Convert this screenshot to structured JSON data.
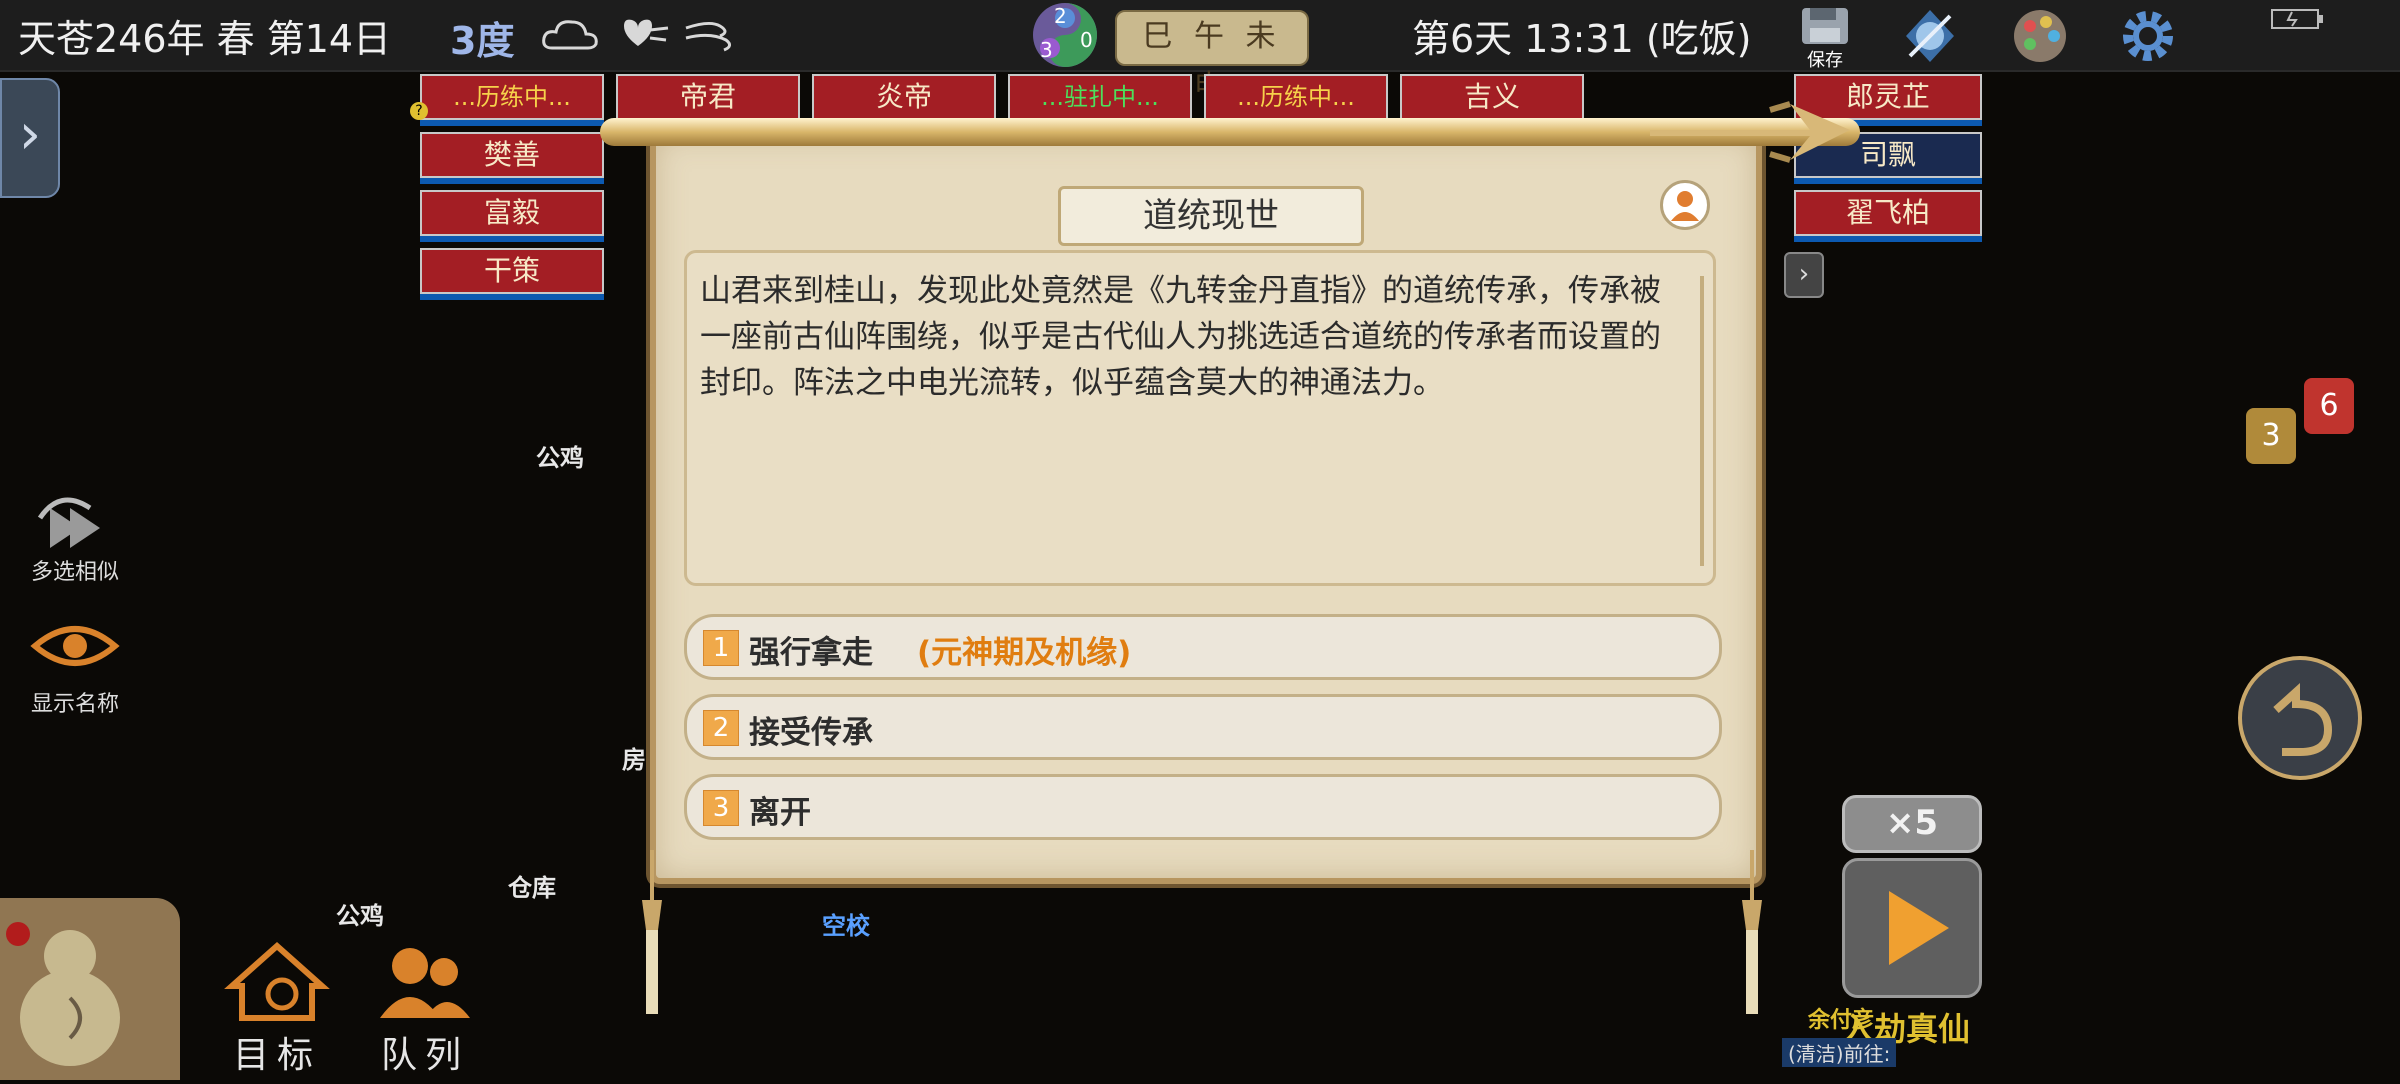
{
  "colors": {
    "accent_gold": "#c9a76a",
    "tag_red": "#a31e24",
    "option_orange": "#e07d10",
    "temp_blue": "#9fb6e8"
  },
  "topbar": {
    "date": "天苍246年 春 第14日",
    "temperature": "3度",
    "clock_labels": "巳 午 未 申",
    "day_time": "第6天 13:31 (吃饭)",
    "save_label": "保存",
    "yin_yang_counts": [
      "2",
      "0",
      "3"
    ]
  },
  "tags": [
    {
      "label": "...历练中...",
      "style": "y"
    },
    {
      "label": "帝君",
      "style": "n"
    },
    {
      "label": "炎帝",
      "style": "n"
    },
    {
      "label": "...驻扎中...",
      "style": "g"
    },
    {
      "label": "...历练中...",
      "style": "y"
    },
    {
      "label": "吉义",
      "style": "n"
    },
    {
      "label": "郎灵芷",
      "style": "n"
    },
    {
      "label": "樊善",
      "style": "n"
    },
    {
      "label": "司飘",
      "style": "n"
    },
    {
      "label": "富毅",
      "style": "n"
    },
    {
      "label": "翟飞柏",
      "style": "n"
    },
    {
      "label": "干策",
      "style": "n"
    }
  ],
  "left_panel": {
    "multi_select": "多选相似",
    "show_names": "显示名称",
    "target": "目标",
    "queue": "队列"
  },
  "map_labels": {
    "rooster1": "公鸡",
    "rooster2": "公鸡",
    "warehouse": "仓库",
    "house": "房",
    "empty_school": "空校"
  },
  "modal": {
    "title": "道统现世",
    "body": "山君来到桂山，发现此处竟然是《九转金丹直指》的道统传承，传承被一座前古仙阵围绕，似乎是古代仙人为挑选适合道统的传承者而设置的封印。阵法之中电光流转，似乎蕴含莫大的神通法力。",
    "options": [
      {
        "num": "1",
        "label": "强行拿走",
        "note": "(元神期及机缘)"
      },
      {
        "num": "2",
        "label": "接受传承",
        "note": ""
      },
      {
        "num": "3",
        "label": "离开",
        "note": ""
      }
    ]
  },
  "right_panel": {
    "bubble_yellow": "3",
    "bubble_red": "6",
    "speed": "×5",
    "status_name": "余付彦",
    "status_title": "入劫真仙",
    "status_action": "(清洁)前往:"
  }
}
